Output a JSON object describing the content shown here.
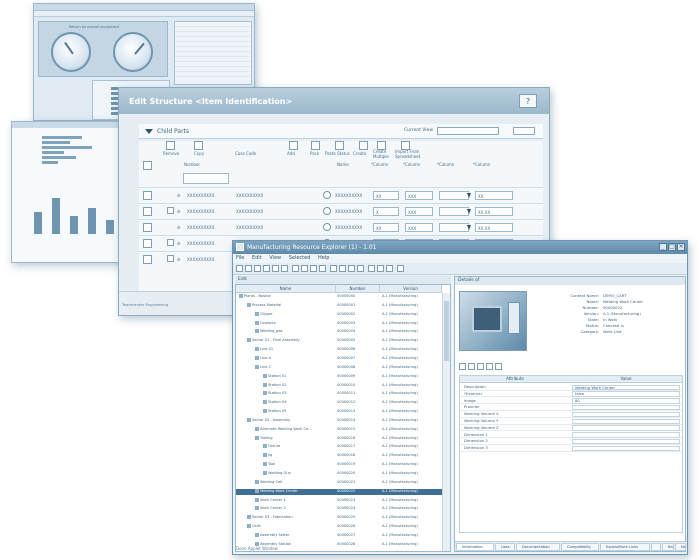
{
  "dashboard": {
    "gauge_title": "Return on overall equipment"
  },
  "edit_dialog": {
    "title": "Edit Structure <Item Identification>",
    "help_label": "?",
    "child_parts_label": "Child Parts",
    "current_view_label": "Current View",
    "column_headers": {
      "remove": "Remove",
      "copy": "Copy",
      "number": "Number",
      "case_code": "Case Code",
      "add": "Add",
      "pack": "Pack",
      "paste_status": "Paste Status",
      "create": "Create",
      "name": "Name",
      "create_multiple": "Create Multiple",
      "import_from_spreadsheet": "Import From Spreadsheet",
      "column1": "*Column",
      "column2": "*Column",
      "column3": "*Column",
      "column4": "*Column"
    },
    "rows": [
      {
        "number": "XXXXXXXXXX",
        "case": "XXXXXXXXXX",
        "name": "XXXXXXXXXX",
        "c1": "XX",
        "c2": "XXX",
        "c4": "XX"
      },
      {
        "number": "XXXXXXXXXX",
        "case": "XXXXXXXXXX",
        "name": "XXXXXXXXXX",
        "c1": "X",
        "c2": "XXX",
        "c4": "XX.XX"
      },
      {
        "number": "XXXXXXXXXX",
        "case": "XXXXXXXXXX",
        "name": "XXXXXXXXXX",
        "c1": "XX",
        "c2": "XXX",
        "c4": "XX.XX"
      },
      {
        "number": "XXXXXXXXXX",
        "case": "XXXXXXXXXX",
        "name": "XXXXXXXXXX",
        "c1": "XX",
        "c2": "XXX",
        "c4": "XX"
      },
      {
        "number": "XXXXXXXXXX",
        "case": "XXXXXXXXXX",
        "name": "XXXXXXXXXX",
        "c1": "XX",
        "c2": "XXX",
        "c4": "XX"
      }
    ],
    "footer_text": "Teamcenter Engineering"
  },
  "mre": {
    "title": "Manufacturing Resource Explorer (1) - 1.01",
    "menu": [
      "File",
      "Edit",
      "View",
      "Selected",
      "Help"
    ],
    "left_header": "Edit",
    "tree_columns": {
      "name": "Name",
      "number": "Number",
      "version": "Version"
    },
    "tree": [
      {
        "name": "Plants - Boston",
        "number": "00000000",
        "version": "A.1 (Manufacturing)",
        "indent": 0
      },
      {
        "name": "Process Material",
        "number": "00000001",
        "version": "A.1 (Manufacturing)",
        "indent": 1
      },
      {
        "name": "Clipper",
        "number": "00000002",
        "version": "A.1 (Manufacturing)",
        "indent": 2
      },
      {
        "name": "Coolants",
        "number": "00000003",
        "version": "A.1 (Manufacturing)",
        "indent": 2
      },
      {
        "name": "Welding_gas",
        "number": "00000004",
        "version": "A.1 (Manufacturing)",
        "indent": 2
      },
      {
        "name": "Sector 01 - Final Assembly",
        "number": "00000005",
        "version": "A.1 (Manufacturing)",
        "indent": 1
      },
      {
        "name": "Line 01",
        "number": "00000006",
        "version": "A.1 (Manufacturing)",
        "indent": 2
      },
      {
        "name": "Line A",
        "number": "00000007",
        "version": "A.1 (Manufacturing)",
        "indent": 2
      },
      {
        "name": "Line C",
        "number": "00000008",
        "version": "A.1 (Manufacturing)",
        "indent": 2
      },
      {
        "name": "Station 01",
        "number": "00000009",
        "version": "A.1 (Manufacturing)",
        "indent": 3
      },
      {
        "name": "Station 02",
        "number": "00000010",
        "version": "A.1 (Manufacturing)",
        "indent": 3
      },
      {
        "name": "Station 03",
        "number": "00000011",
        "version": "A.1 (Manufacturing)",
        "indent": 3
      },
      {
        "name": "Station 04",
        "number": "00000012",
        "version": "A.1 (Manufacturing)",
        "indent": 3
      },
      {
        "name": "Station 05",
        "number": "00000013",
        "version": "A.1 (Manufacturing)",
        "indent": 3
      },
      {
        "name": "Sector 02 - Assembly",
        "number": "00000014",
        "version": "A.1 (Manufacturing)",
        "indent": 1
      },
      {
        "name": "Alternate Welding Work Ce...",
        "number": "00000015",
        "version": "A.1 (Manufacturing)",
        "indent": 2
      },
      {
        "name": "Tooling",
        "number": "00000016",
        "version": "A.1 (Manufacturing)",
        "indent": 2
      },
      {
        "name": "Fixture",
        "number": "00000017",
        "version": "A.1 (Manufacturing)",
        "indent": 3
      },
      {
        "name": "Jig",
        "number": "00000018",
        "version": "A.1 (Manufacturing)",
        "indent": 3
      },
      {
        "name": "Tool",
        "number": "00000019",
        "version": "A.1 (Manufacturing)",
        "indent": 3
      },
      {
        "name": "Welding Gun",
        "number": "00000020",
        "version": "A.1 (Manufacturing)",
        "indent": 3
      },
      {
        "name": "Welding Cell",
        "number": "00000021",
        "version": "A.1 (Manufacturing)",
        "indent": 2
      },
      {
        "name": "Welding Work Center",
        "number": "00000022",
        "version": "A.1 (Manufacturing)",
        "indent": 2,
        "selected": true
      },
      {
        "name": "Work Center 1",
        "number": "00000023",
        "version": "A.1 (Manufacturing)",
        "indent": 2
      },
      {
        "name": "Work Center 2",
        "number": "00000024",
        "version": "A.1 (Manufacturing)",
        "indent": 2
      },
      {
        "name": "Sector 03 - Fabrication",
        "number": "00000025",
        "version": "A.1 (Manufacturing)",
        "indent": 1
      },
      {
        "name": "Cells",
        "number": "00000026",
        "version": "A.1 (Manufacturing)",
        "indent": 1
      },
      {
        "name": "Assembly Setter",
        "number": "00000027",
        "version": "A.1 (Manufacturing)",
        "indent": 2
      },
      {
        "name": "Assembly Station",
        "number": "00000028",
        "version": "A.1 (Manufacturing)",
        "indent": 2
      }
    ],
    "details_title": "Details of",
    "properties": [
      {
        "k": "Context Name:",
        "v": "DEMO_CART"
      },
      {
        "k": "Name:",
        "v": "Welding Work Center"
      },
      {
        "k": "Number:",
        "v": "00000022"
      },
      {
        "k": "Version:",
        "v": "A.1 (Manufacturing)"
      },
      {
        "k": "State:",
        "v": "In Work"
      },
      {
        "k": "Status:",
        "v": "Checked in"
      },
      {
        "k": "Category:",
        "v": "Work Unit"
      }
    ],
    "attr_columns": {
      "attribute": "Attribute",
      "value": "Value"
    },
    "attributes": [
      {
        "a": "Description",
        "b": "Welding Work Center"
      },
      {
        "a": "*External",
        "b": "false"
      },
      {
        "a": "Image",
        "b": "80"
      },
      {
        "a": "Provider",
        "b": ""
      },
      {
        "a": "Working Volume X",
        "b": ""
      },
      {
        "a": "Working Volume Y",
        "b": ""
      },
      {
        "a": "Working Volume Z",
        "b": ""
      },
      {
        "a": "Dimension 1",
        "b": ""
      },
      {
        "a": "Dimension 2",
        "b": ""
      },
      {
        "a": "Dimension 3",
        "b": ""
      }
    ],
    "tabs": [
      "Information",
      "Uses",
      "Documentation",
      "Compatibility",
      "Expenditure Links",
      "",
      "Back",
      "Next"
    ],
    "status": "Done Applet Window"
  }
}
